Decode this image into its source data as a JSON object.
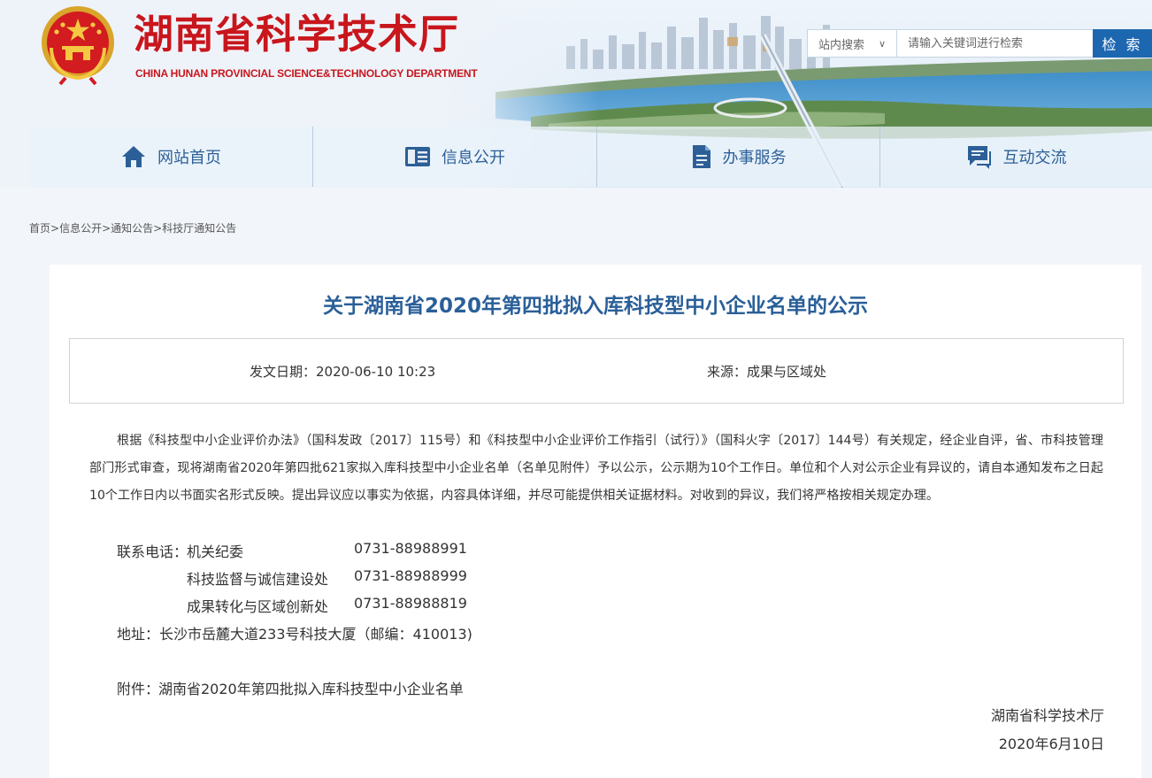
{
  "header": {
    "title": "湖南省科学技术厅",
    "subtitle": "CHINA HUNAN PROVINCIAL SCIENCE&TECHNOLOGY DEPARTMENT",
    "brand_color": "#c8161d"
  },
  "search": {
    "scope": "站内搜索",
    "placeholder": "请输入关键词进行检索",
    "button": "检 索"
  },
  "nav": {
    "items": [
      {
        "label": "网站首页",
        "icon": "home-icon"
      },
      {
        "label": "信息公开",
        "icon": "info-panel-icon"
      },
      {
        "label": "办事服务",
        "icon": "document-icon"
      },
      {
        "label": "互动交流",
        "icon": "chat-icon"
      }
    ]
  },
  "breadcrumb": {
    "items": [
      "首页",
      "信息公开",
      "通知公告",
      "科技厅通知公告"
    ],
    "separator": ">"
  },
  "article": {
    "title": "关于湖南省2020年第四批拟入库科技型中小企业名单的公示",
    "date_label": "发文日期：2020-06-10 10:23",
    "source_label": "来源：成果与区域处",
    "paragraph": "根据《科技型中小企业评价办法》（国科发政〔2017〕115号）和《科技型中小企业评价工作指引（试行）》（国科火字〔2017〕144号）有关规定，经企业自评，省、市科技管理部门形式审查，现将湖南省2020年第四批621家拟入库科技型中小企业名单（名单见附件）予以公示，公示期为10个工作日。单位和个人对公示企业有异议的，请自本通知发布之日起  10个工作日内以书面实名形式反映。提出异议应以事实为依据，内容具体详细，并尽可能提供相关证据材料。对收到的异议，我们将严格按相关规定办理。",
    "contacts": {
      "label": "联系电话：",
      "rows": [
        {
          "dept": "机关纪委",
          "phone": "0731-88988991"
        },
        {
          "dept": "科技监督与诚信建设处",
          "phone": "0731-88988999"
        },
        {
          "dept": "成果转化与区域创新处",
          "phone": "0731-88988819"
        }
      ]
    },
    "address": "地址：长沙市岳麓大道233号科技大厦（邮编：410013)",
    "attachment_label": "附件：",
    "attachment_link": "湖南省2020年第四批拟入库科技型中小企业名单",
    "signature_org": "湖南省科学技术厅",
    "signature_date": "2020年6月10日"
  },
  "colors": {
    "accent": "#1d67b1",
    "title_blue": "#2a5f98",
    "nav_text": "#2c5f97"
  }
}
